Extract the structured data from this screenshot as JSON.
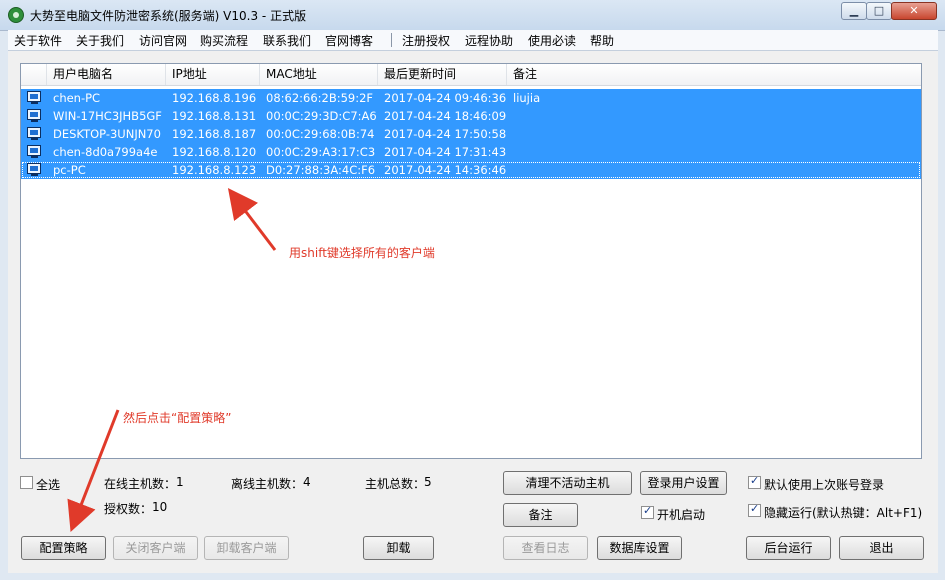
{
  "window": {
    "title": "大势至电脑文件防泄密系统(服务端) V10.3 - 正式版",
    "min_glyph": "▁",
    "max_glyph": "□",
    "close_glyph": "✕"
  },
  "menu": {
    "items": [
      "关于软件",
      "关于我们",
      "访问官网",
      "购买流程",
      "联系我们",
      "官网博客",
      "注册授权",
      "远程协助",
      "使用必读",
      "帮助"
    ]
  },
  "list": {
    "columns": [
      "用户电脑名",
      "IP地址",
      "MAC地址",
      "最后更新时间",
      "备注"
    ],
    "rows": [
      {
        "name": "chen-PC",
        "ip": "192.168.8.196",
        "mac": "08:62:66:2B:59:2F",
        "time": "2017-04-24 09:46:36",
        "note": "liujia",
        "selected": true
      },
      {
        "name": "WIN-17HC3JHB5GF",
        "ip": "192.168.8.131",
        "mac": "00:0C:29:3D:C7:A6",
        "time": "2017-04-24 18:46:09",
        "note": "",
        "selected": true
      },
      {
        "name": "DESKTOP-3UNJN70",
        "ip": "192.168.8.187",
        "mac": "00:0C:29:68:0B:74",
        "time": "2017-04-24 17:50:58",
        "note": "",
        "selected": true
      },
      {
        "name": "chen-8d0a799a4e",
        "ip": "192.168.8.120",
        "mac": "00:0C:29:A3:17:C3",
        "time": "2017-04-24 17:31:43",
        "note": "",
        "selected": true
      },
      {
        "name": "pc-PC",
        "ip": "192.168.8.123",
        "mac": "D0:27:88:3A:4C:F6",
        "time": "2017-04-24 14:36:46",
        "note": "",
        "selected": true
      }
    ]
  },
  "annotations": {
    "shift_hint": "用shift键选择所有的客户端",
    "click_hint": "然后点击“配置策略”",
    "color": "#e03a2a"
  },
  "status": {
    "select_all": "全选",
    "online_label": "在线主机数：",
    "online_value": "1",
    "offline_label": "离线主机数：",
    "offline_value": "4",
    "total_label": "主机总数：",
    "total_value": "5",
    "license_label": "授权数：",
    "license_value": "10"
  },
  "buttons": {
    "clean_inactive": "清理不活动主机",
    "login_user_settings": "登录用户设置",
    "note": "备注",
    "config_policy": "配置策略",
    "close_client": "关闭客户端",
    "uninstall_client": "卸载客户端",
    "uninstall": "卸载",
    "view_log": "查看日志",
    "db_settings": "数据库设置",
    "background_run": "后台运行",
    "exit": "退出"
  },
  "options": {
    "use_last_account": "默认使用上次账号登录",
    "autostart": "开机启动",
    "hidden_run": "隐藏运行(默认热键：Alt+F1)"
  }
}
